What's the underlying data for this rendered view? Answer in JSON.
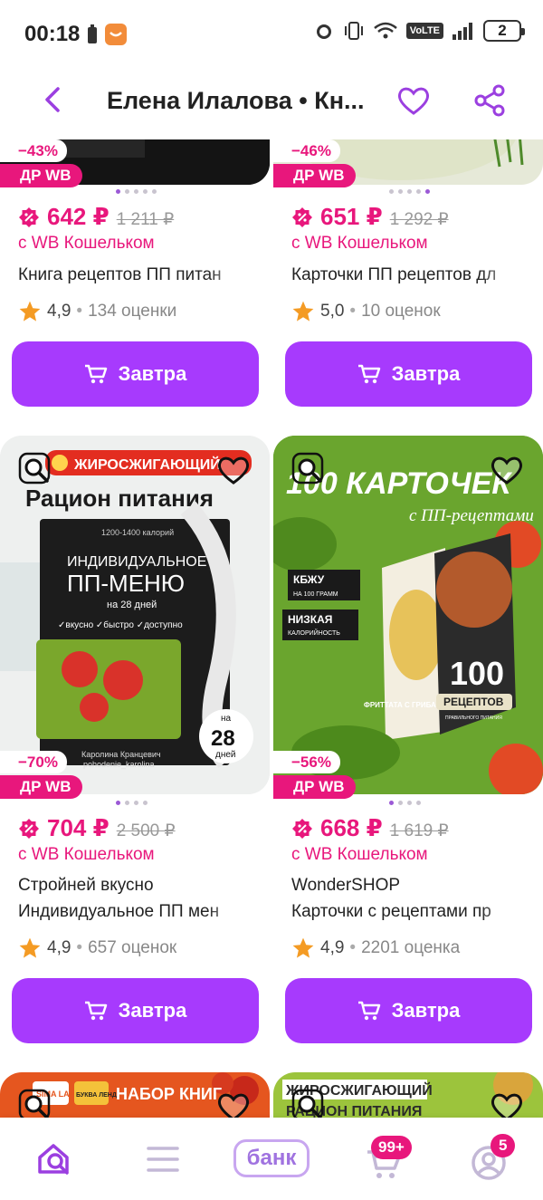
{
  "status_bar": {
    "time": "00:18",
    "network": "VoLTE",
    "battery_level": "2"
  },
  "header": {
    "title": "Елена Илалова • Кн..."
  },
  "products": [
    {
      "discount": "−43%",
      "promo_badge": "ДР WB",
      "price": "642 ₽",
      "old_price": "1 211 ₽",
      "wallet_note": "с WB Кошельком",
      "name_line1": "Книга рецептов ПП питан",
      "name_line2": "",
      "rating": "4,9",
      "reviews": "134 оценки",
      "button": "Завтра"
    },
    {
      "discount": "−46%",
      "promo_badge": "ДР WB",
      "price": "651 ₽",
      "old_price": "1 292 ₽",
      "wallet_note": "с WB Кошельком",
      "name_line1": "Карточки ПП рецептов дл",
      "name_line2": "",
      "rating": "5,0",
      "reviews": "10 оценок",
      "button": "Завтра"
    },
    {
      "discount": "−70%",
      "promo_badge": "ДР WB",
      "price": "704 ₽",
      "old_price": "2 500 ₽",
      "wallet_note": "с WB Кошельком",
      "name_line1": "Стройней вкусно",
      "name_line2": "Индивидуальное ПП мен",
      "rating": "4,9",
      "reviews": "657 оценок",
      "button": "Завтра",
      "image_text": {
        "banner": "ЖИРОСЖИГАЮЩИЙ",
        "title": "Рацион питания",
        "cal": "1200-1400 калорий",
        "line1": "ИНДИВИДУАЛЬНОЕ",
        "line2": "ПП-МЕНЮ",
        "days_line": "на 28 дней",
        "features": "✓вкусно  ✓быстро  ✓доступно",
        "author": "Каролина Кранцевич",
        "handle": "pohodenie_karolina",
        "circle_top": "на",
        "circle_num": "28",
        "circle_bottom": "дней"
      }
    },
    {
      "discount": "−56%",
      "promo_badge": "ДР WB",
      "price": "668 ₽",
      "old_price": "1 619 ₽",
      "wallet_note": "с WB Кошельком",
      "name_line1": "WonderSHOP",
      "name_line2": "Карточки с рецептами пр",
      "rating": "4,9",
      "reviews": "2201 оценка",
      "button": "Завтра",
      "image_text": {
        "title1": "100 КАРТОЧЕК",
        "title2": "с ПП-рецептами",
        "tag1": "КБЖУ",
        "tag1_sub": "НА 100 ГРАММ",
        "tag2": "НИЗКАЯ",
        "tag2_sub": "КАЛОРИЙНОСТЬ",
        "box_num": "100",
        "box_label": "РЕЦЕПТОВ",
        "box_sub": "ПРАВИЛЬНОГО ПИТАНИЯ",
        "card_label": "ФРИТТАТА С ГРИБАМИ И ШПИНАТОМ"
      }
    }
  ],
  "partial_row": {
    "left_text": "НАБОР КНИГ",
    "left_logo1": "SIMA LAND",
    "left_logo2": "БУКВА ЛЕНД",
    "right_text1": "ЖИРОСЖИГАЮЩИЙ",
    "right_text2": "РАЦИОН ПИТАНИЯ"
  },
  "bottom_nav": {
    "bank_label": "банк",
    "cart_badge": "99+",
    "profile_badge": "5"
  },
  "colors": {
    "accent": "#a73afd",
    "price": "#e8177c",
    "brand_purple": "#9b3fe0"
  }
}
